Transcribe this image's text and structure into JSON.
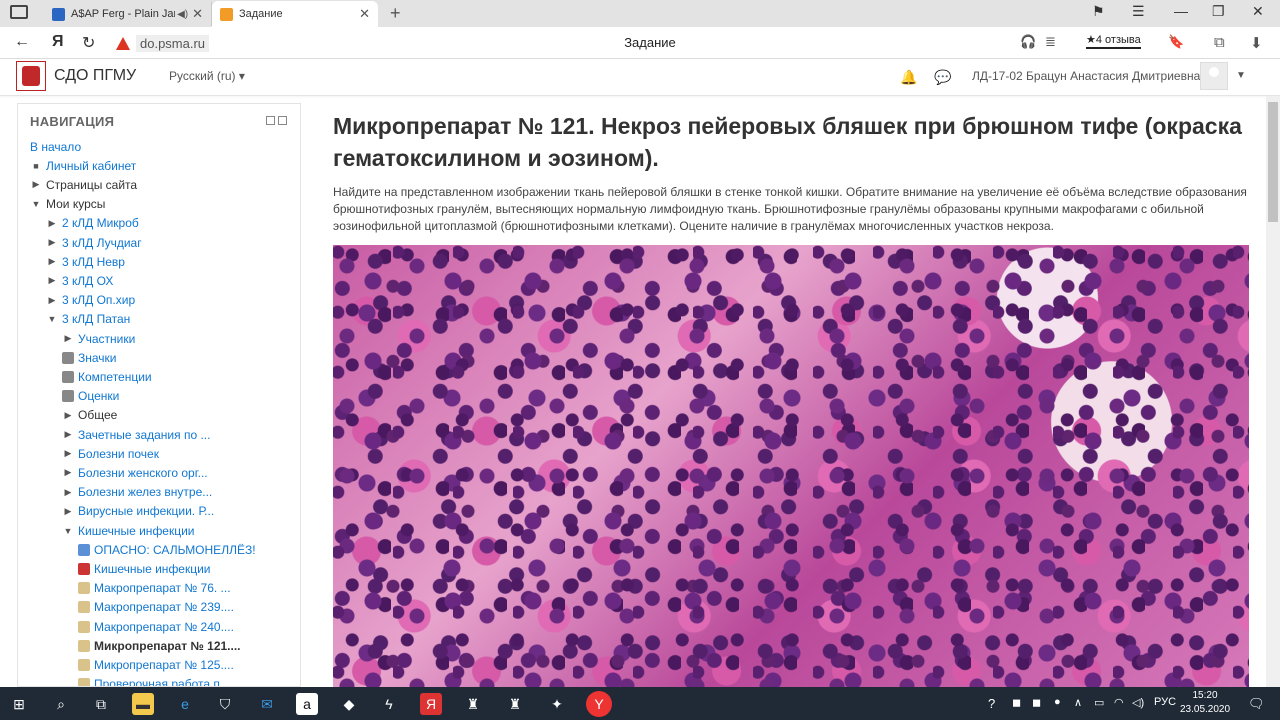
{
  "browser": {
    "tabs": [
      {
        "title": "A$AP Ferg - Plain Jan",
        "favicon_color": "#2b66c2"
      },
      {
        "title": "Задание",
        "favicon_color": "#f29b27"
      }
    ],
    "url": "do.psma.ru",
    "page_title": "Задание",
    "reviews": "★4 отзыва"
  },
  "header": {
    "site_name": "СДО ПГМУ",
    "language": "Русский (ru) ▾",
    "user": "ЛД-17-02 Брацун Анастасия Дмитриевна"
  },
  "nav": {
    "title": "НАВИГАЦИЯ",
    "items": [
      {
        "label": "В начало",
        "style": "link",
        "level": 0,
        "arrow": "",
        "icon": ""
      },
      {
        "label": "Личный кабинет",
        "style": "link",
        "level": 1,
        "arrow": "■",
        "icon": ""
      },
      {
        "label": "Страницы сайта",
        "style": "plain",
        "level": 1,
        "arrow": "▶",
        "icon": ""
      },
      {
        "label": "Мои курсы",
        "style": "plain",
        "level": 1,
        "arrow": "▼",
        "icon": ""
      },
      {
        "label": "2 кЛД Микроб",
        "style": "link",
        "level": 2,
        "arrow": "▶",
        "icon": ""
      },
      {
        "label": "3 кЛД Лучдиаг",
        "style": "link",
        "level": 2,
        "arrow": "▶",
        "icon": ""
      },
      {
        "label": "3 кЛД Невр",
        "style": "link",
        "level": 2,
        "arrow": "▶",
        "icon": ""
      },
      {
        "label": "3 кЛД ОХ",
        "style": "link",
        "level": 2,
        "arrow": "▶",
        "icon": ""
      },
      {
        "label": "3 кЛД Оп.хир",
        "style": "link",
        "level": 2,
        "arrow": "▶",
        "icon": ""
      },
      {
        "label": "3 кЛД Патан",
        "style": "link",
        "level": 2,
        "arrow": "▼",
        "icon": ""
      },
      {
        "label": "Участники",
        "style": "link",
        "level": 3,
        "arrow": "▶",
        "icon": ""
      },
      {
        "label": "Значки",
        "style": "link",
        "level": 3,
        "arrow": "",
        "icon": "#888"
      },
      {
        "label": "Компетенции",
        "style": "link",
        "level": 3,
        "arrow": "",
        "icon": "#888"
      },
      {
        "label": "Оценки",
        "style": "link",
        "level": 3,
        "arrow": "",
        "icon": "#888"
      },
      {
        "label": "Общее",
        "style": "plain",
        "level": 3,
        "arrow": "▶",
        "icon": ""
      },
      {
        "label": "Зачетные задания по ...",
        "style": "link",
        "level": 3,
        "arrow": "▶",
        "icon": ""
      },
      {
        "label": "Болезни почек",
        "style": "link",
        "level": 3,
        "arrow": "▶",
        "icon": ""
      },
      {
        "label": "Болезни женского орг...",
        "style": "link",
        "level": 3,
        "arrow": "▶",
        "icon": ""
      },
      {
        "label": "Болезни желез внутре...",
        "style": "link",
        "level": 3,
        "arrow": "▶",
        "icon": ""
      },
      {
        "label": "Вирусные инфекции. Р...",
        "style": "link",
        "level": 3,
        "arrow": "▶",
        "icon": ""
      },
      {
        "label": "Кишечные инфекции",
        "style": "link",
        "level": 3,
        "arrow": "▼",
        "icon": ""
      },
      {
        "label": "ОПАСНО: САЛЬМОНЕЛЛЁЗ!",
        "style": "link",
        "level": 4,
        "arrow": "",
        "icon": "#5b8fd6"
      },
      {
        "label": "Кишечные инфекции",
        "style": "link",
        "level": 4,
        "arrow": "",
        "icon": "#c33"
      },
      {
        "label": "Макропрепарат № 76. ...",
        "style": "link",
        "level": 4,
        "arrow": "",
        "icon": "#d9c38a"
      },
      {
        "label": "Макропрепарат № 239....",
        "style": "link",
        "level": 4,
        "arrow": "",
        "icon": "#d9c38a"
      },
      {
        "label": "Макропрепарат № 240....",
        "style": "link",
        "level": 4,
        "arrow": "",
        "icon": "#d9c38a"
      },
      {
        "label": "Микропрепарат № 121....",
        "style": "active",
        "level": 4,
        "arrow": "",
        "icon": "#d9c38a"
      },
      {
        "label": "Микропрепарат № 125....",
        "style": "link",
        "level": 4,
        "arrow": "",
        "icon": "#d9c38a"
      },
      {
        "label": "Проверочная работа п...",
        "style": "link",
        "level": 4,
        "arrow": "",
        "icon": "#d9c38a"
      }
    ]
  },
  "main": {
    "title": "Микропрепарат № 121. Некроз пейеровых бляшек при брюшном тифе (окраска гематоксилином и эозином).",
    "description": "Найдите на представленном изображении ткань пейеровой бляшки в стенке тонкой кишки. Обратите внимание на увеличение её объёма вследствие образования брюшнотифозных гранулём, вытесняющих нормальную лимфоидную ткань. Брюшнотифозные гранулёмы образованы крупными макрофагами с обильной эозинофильной цитоплазмой (брюшнотифозными клетками). Оцените наличие в гранулёмах многочисленных участков некроза."
  },
  "taskbar": {
    "language": "РУС",
    "time": "15:20",
    "date": "23.05.2020"
  }
}
